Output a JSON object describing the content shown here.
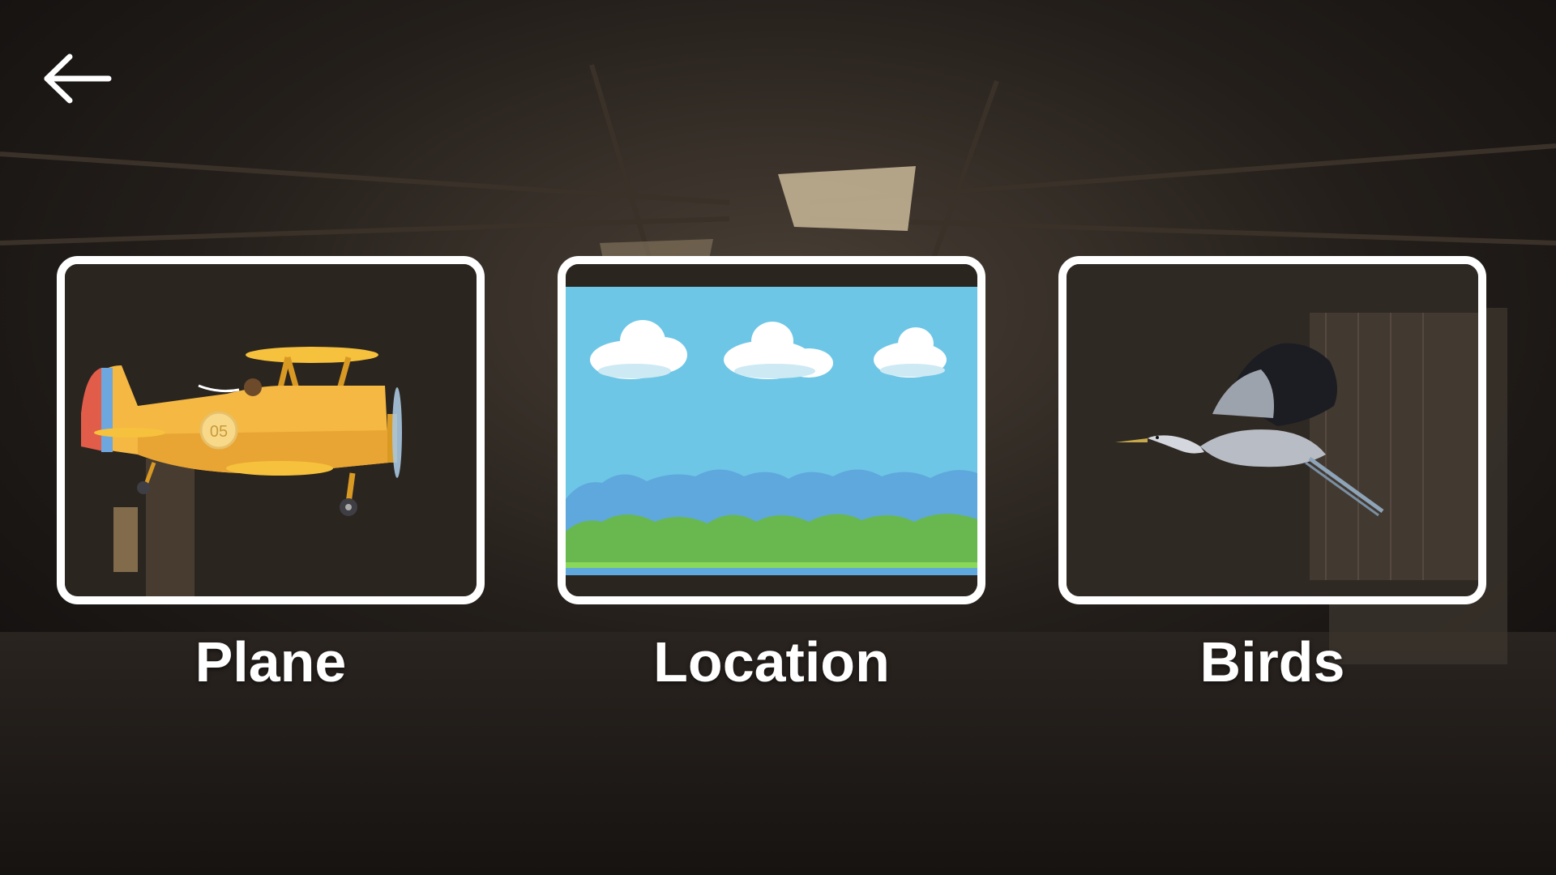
{
  "screen": "select-category",
  "nav": {
    "back_icon": "arrow-left-icon"
  },
  "options": [
    {
      "id": "plane",
      "label": "Plane",
      "image": "yellow-biplane",
      "plane_number": "05"
    },
    {
      "id": "location",
      "label": "Location",
      "image": "pixel-sky-clouds-hills"
    },
    {
      "id": "birds",
      "label": "Birds",
      "image": "flying-heron"
    }
  ],
  "colors": {
    "card_border": "#ffffff",
    "label_text": "#ffffff",
    "plane_body": "#f4b843",
    "sky": "#6ec6e6",
    "grass": "#68b84f"
  }
}
